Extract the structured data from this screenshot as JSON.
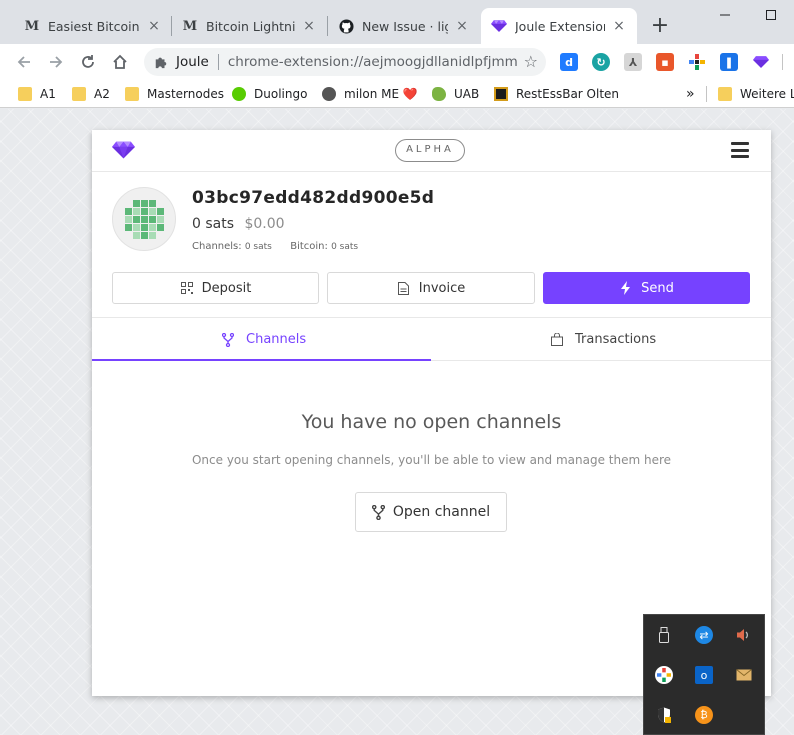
{
  "browser": {
    "tabs": [
      {
        "title": "Easiest Bitcoin Lig",
        "favicon": "M",
        "active": false
      },
      {
        "title": "Bitcoin Lightning",
        "favicon": "M",
        "active": false
      },
      {
        "title": "New Issue · lightn",
        "favicon": "github-icon",
        "active": false
      },
      {
        "title": "Joule Extension",
        "favicon": "joule-gem-icon",
        "active": true
      }
    ],
    "new_tab_label": "+",
    "close_glyph": "×",
    "omnibox": {
      "extension_name": "Joule",
      "url": "chrome-extension://aejmoogjdllanidlpfjmmmmdoklkfcldh/index.html"
    },
    "bookmarks": [
      {
        "label": "A1",
        "icon": "folder-icon"
      },
      {
        "label": "A2",
        "icon": "folder-icon"
      },
      {
        "label": "Masternodes",
        "icon": "folder-icon"
      },
      {
        "label": "Duolingo",
        "icon": "duolingo-icon"
      },
      {
        "label": "milon ME ❤️",
        "icon": "globe-icon"
      },
      {
        "label": "UAB",
        "icon": "uab-icon"
      },
      {
        "label": "RestEssBar Olten",
        "icon": "restaurant-icon"
      }
    ],
    "bookmarks_overflow": "»",
    "other_bookmarks": "Weitere Le"
  },
  "joule": {
    "badge": "ALPHA",
    "node": {
      "pubkey": "03bc97edd482dd900e5d",
      "balance_sats": "0 sats",
      "balance_fiat": "$0.00",
      "channels_label": "Channels:",
      "channels_value": "0 sats",
      "bitcoin_label": "Bitcoin:",
      "bitcoin_value": "0 sats"
    },
    "actions": {
      "deposit": "Deposit",
      "invoice": "Invoice",
      "send": "Send"
    },
    "tabs": {
      "channels": "Channels",
      "transactions": "Transactions"
    },
    "empty": {
      "title": "You have no open channels",
      "text": "Once you start opening channels, you'll be able to view and manage them here",
      "button": "Open channel"
    },
    "colors": {
      "accent": "#7642ff",
      "identicon": "#5cb878"
    }
  }
}
